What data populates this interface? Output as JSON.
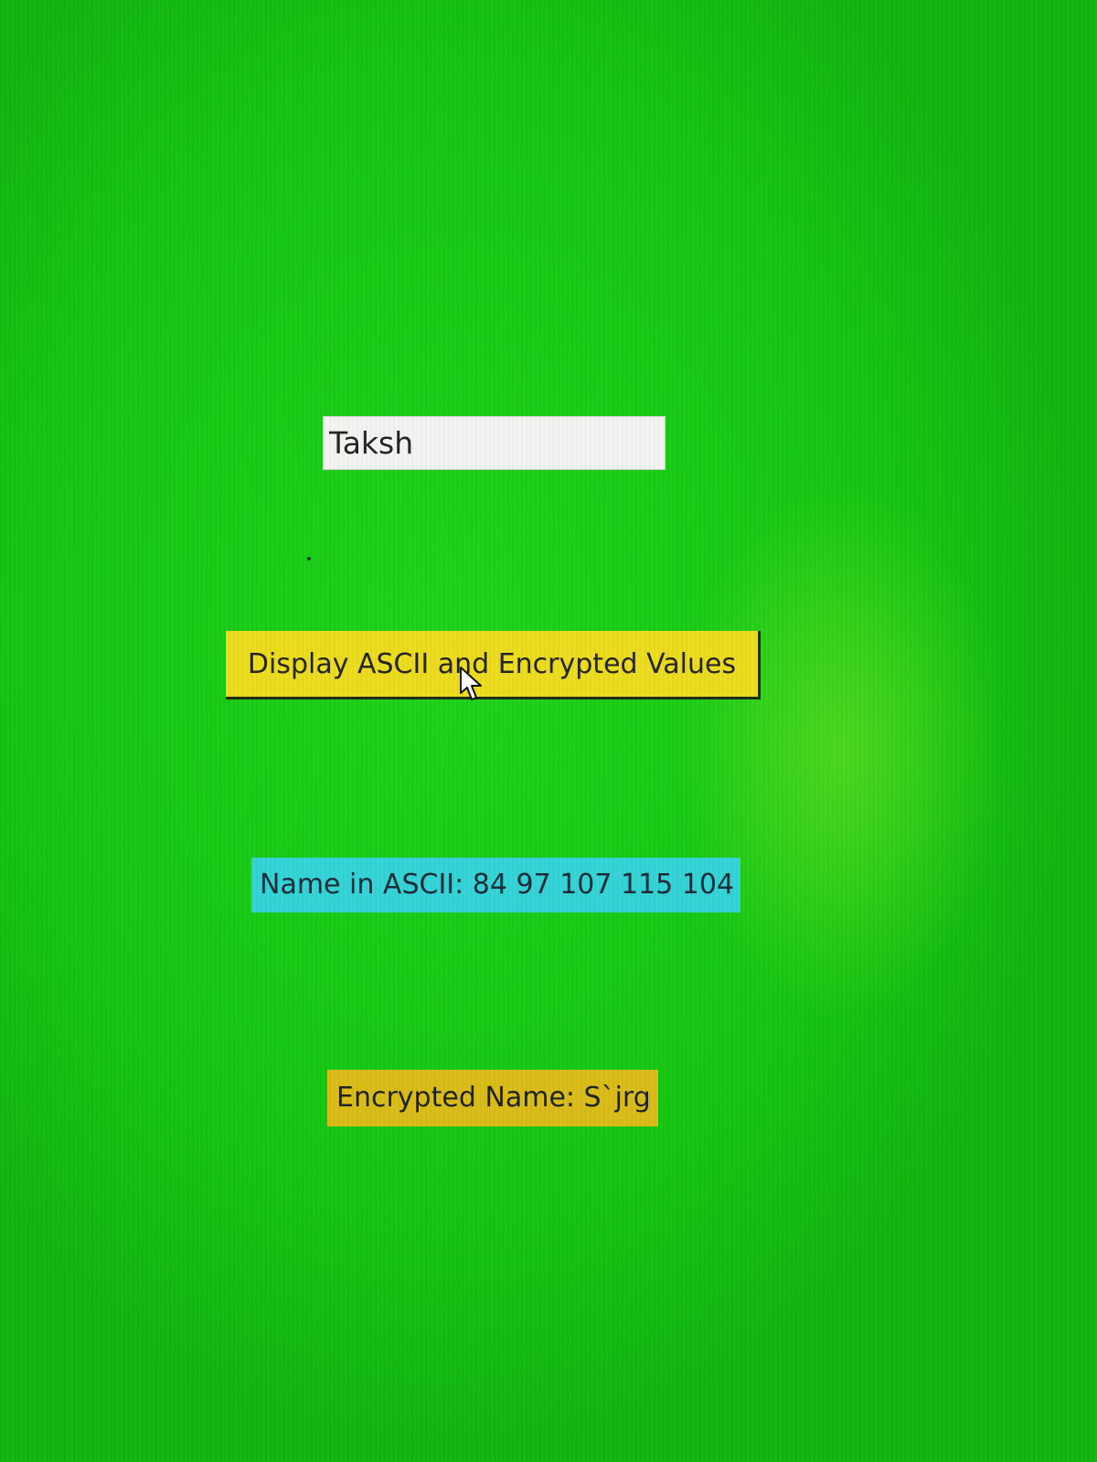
{
  "window": {
    "background_color": "#18c814"
  },
  "name_field": {
    "value": "Taksh"
  },
  "display_button": {
    "label": "Display ASCII and Encrypted Values",
    "background_color": "#ecdc1e"
  },
  "ascii_output": {
    "text": "Name in ASCII: 84 97 107 115 104",
    "background_color": "#33d3d6"
  },
  "encrypted_output": {
    "text": "Encrypted Name: S`jrg",
    "background_color": "#d9bc18"
  },
  "cursor": {
    "icon": "mouse-pointer-icon"
  }
}
